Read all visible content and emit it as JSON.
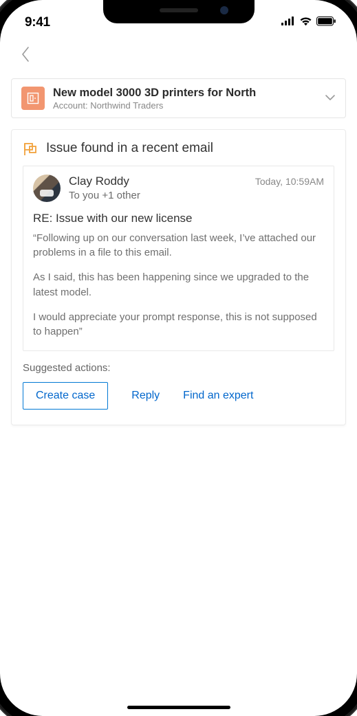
{
  "status": {
    "time": "9:41"
  },
  "context": {
    "title": "New model 3000 3D printers for North",
    "subtitle": "Account: Northwind Traders"
  },
  "issue": {
    "heading": "Issue found in a recent email",
    "email": {
      "sender": "Clay Roddy",
      "timestamp": "Today, 10:59AM",
      "recipients": "To you +1 other",
      "subject": "RE: Issue with our new license",
      "paragraphs": [
        "“Following up on our conversation last week, I’ve attached our problems in a file to this email.",
        "As I said, this has been happening since we upgraded to the latest model.",
        "I would appreciate your prompt response, this is not supposed to happen”"
      ]
    },
    "suggested_label": "Suggested actions:",
    "actions": {
      "create_case": "Create case",
      "reply": "Reply",
      "find_expert": "Find an expert"
    }
  }
}
